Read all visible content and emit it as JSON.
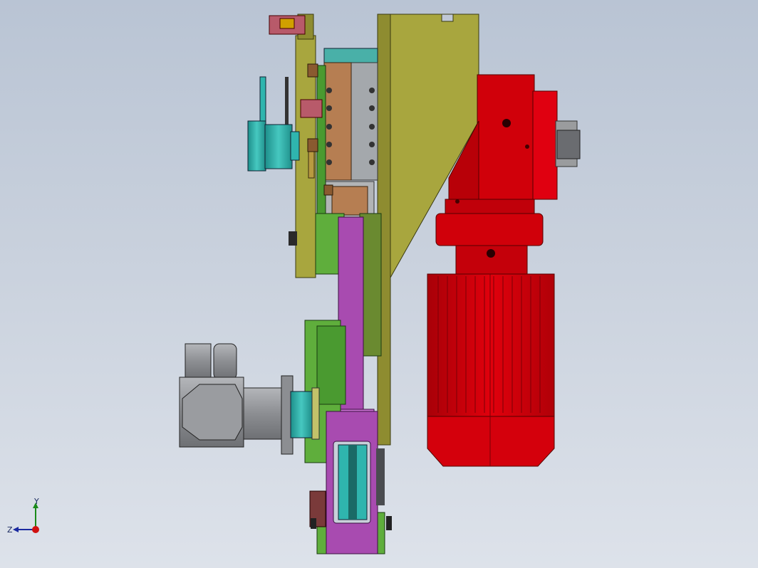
{
  "viewport": {
    "background_top": "#b9c4d4",
    "background_bottom": "#dde2ea"
  },
  "colors": {
    "gearbox_red": "#d0000a",
    "gearbox_dark": "#8a0005",
    "olive_plate": "#a8a63e",
    "olive_dark": "#6e6c22",
    "magenta_arm": "#a84bb0",
    "magenta_light": "#c86fd0",
    "green_block": "#5fae3c",
    "teal": "#2fb5ae",
    "brown_block": "#b07a50",
    "grey_metal": "#9c9ea2",
    "dark_metal": "#4a4c50",
    "pink_clamp": "#b85a6a"
  },
  "triad": {
    "y_label": "Y",
    "z_label": "Z",
    "icons": [
      "axis-y-icon",
      "axis-z-icon",
      "axis-origin-icon"
    ]
  }
}
